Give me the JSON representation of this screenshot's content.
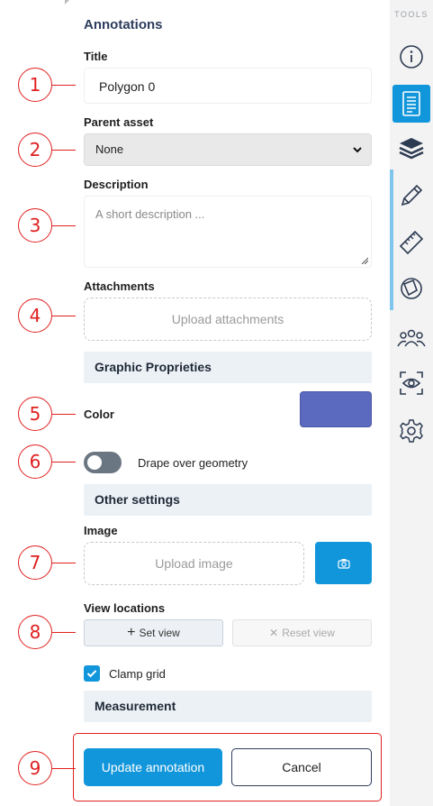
{
  "panel": {
    "heading": "Annotations",
    "title_label": "Title",
    "title_value": "Polygon 0",
    "parent_label": "Parent asset",
    "parent_selected": "None",
    "description_label": "Description",
    "description_placeholder": "A short description ...",
    "attachments_label": "Attachments",
    "attachments_upload": "Upload attachments",
    "graphic_section": "Graphic Proprieties",
    "color_label": "Color",
    "color_value": "#5b6abf",
    "drape_label": "Drape over geometry",
    "drape_enabled": false,
    "other_section": "Other settings",
    "image_label": "Image",
    "image_upload": "Upload image",
    "view_locations_label": "View locations",
    "set_view": "Set view",
    "reset_view": "Reset view",
    "clamp_grid_label": "Clamp grid",
    "clamp_grid_checked": true,
    "measurement_section": "Measurement",
    "update_button": "Update annotation",
    "cancel_button": "Cancel"
  },
  "callouts": [
    "1",
    "2",
    "3",
    "4",
    "5",
    "6",
    "7",
    "8",
    "9"
  ],
  "toolbar": {
    "label": "TOOLS",
    "items": [
      {
        "icon": "info-icon",
        "active": false
      },
      {
        "icon": "document-list-icon",
        "active": true
      },
      {
        "icon": "layers-icon",
        "active": false
      },
      {
        "icon": "pencil-icon",
        "active": false
      },
      {
        "icon": "ruler-icon",
        "active": false
      },
      {
        "icon": "shape-circle-icon",
        "active": false
      },
      {
        "icon": "people-icon",
        "active": false
      },
      {
        "icon": "eye-scan-icon",
        "active": false
      },
      {
        "icon": "gear-icon",
        "active": false
      }
    ]
  },
  "colors": {
    "accent": "#1296db",
    "callout_red": "#e02020",
    "section_bg": "#ecf1f6"
  }
}
